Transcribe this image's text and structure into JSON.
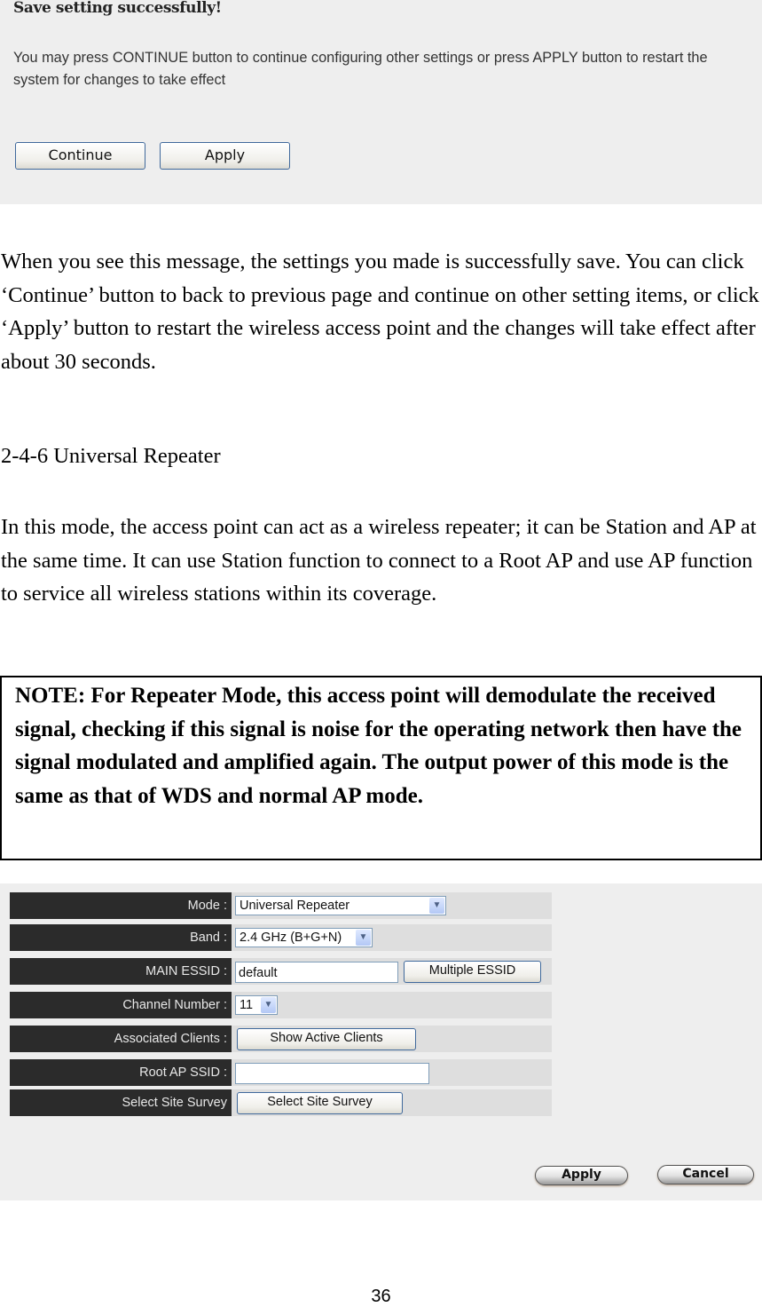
{
  "save_dialog": {
    "title": "Save setting successfully!",
    "message": "You may press CONTINUE button to continue configuring other settings or press APPLY button to restart the system for changes to take effect",
    "continue_label": "Continue",
    "apply_label": "Apply"
  },
  "doc": {
    "paragraph_1": "When you see this message, the settings you made is successfully save. You can click ‘Continue’ button to back to previous page and continue on other setting items, or click ‘Apply’ button to restart the wireless access point and the changes will take effect after about 30 seconds.",
    "section_heading": "2-4-6 Universal Repeater",
    "paragraph_2": "In this mode, the access point can act as a wireless repeater; it can be Station and AP at the same time. It can use Station function to connect to a Root AP and use AP function to service all wireless stations within its coverage.",
    "note": "NOTE: For Repeater Mode, this access point will demodulate the received signal, checking if this signal is noise for the operating network then have the signal modulated and amplified again. The output power of this mode is the same as that of WDS and normal AP mode.",
    "page_number": "36"
  },
  "repeater_form": {
    "mode": {
      "label": "Mode :",
      "value": "Universal Repeater"
    },
    "band": {
      "label": "Band :",
      "value": "2.4 GHz (B+G+N)"
    },
    "main_essid": {
      "label": "MAIN ESSID :",
      "value": "default",
      "button": "Multiple ESSID"
    },
    "channel": {
      "label": "Channel Number :",
      "value": "11"
    },
    "associated_clients": {
      "label": "Associated Clients :",
      "button": "Show Active Clients"
    },
    "root_ap_ssid": {
      "label": "Root AP SSID :",
      "value": ""
    },
    "site_survey": {
      "label": "Select Site Survey",
      "button": "Select Site Survey"
    },
    "apply_label": "Apply",
    "cancel_label": "Cancel",
    "dropdown_icon": "chevron-down-icon"
  }
}
